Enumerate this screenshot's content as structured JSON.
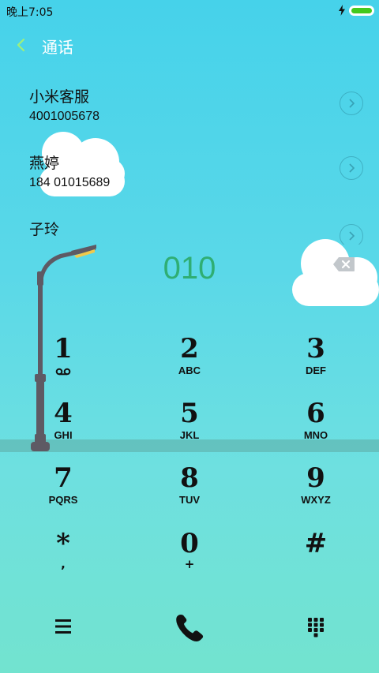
{
  "status_bar": {
    "time": "晚上7:05",
    "battery_level": 1.0,
    "charging": true
  },
  "header": {
    "title": "通话",
    "back_icon": "chevron-left-icon"
  },
  "contacts": [
    {
      "name": "小米客服",
      "number": "4001005678"
    },
    {
      "name": "燕婷",
      "number": "184 01015689"
    },
    {
      "name": "子玲",
      "number": ""
    }
  ],
  "dialed_number": "010",
  "keypad": [
    {
      "digit": "1",
      "sub": "voicemail-icon"
    },
    {
      "digit": "2",
      "sub": "ABC"
    },
    {
      "digit": "3",
      "sub": "DEF"
    },
    {
      "digit": "4",
      "sub": "GHI"
    },
    {
      "digit": "5",
      "sub": "JKL"
    },
    {
      "digit": "6",
      "sub": "MNO"
    },
    {
      "digit": "7",
      "sub": "PQRS"
    },
    {
      "digit": "8",
      "sub": "TUV"
    },
    {
      "digit": "9",
      "sub": "WXYZ"
    },
    {
      "digit": "*",
      "sub": ","
    },
    {
      "digit": "0",
      "sub": "+"
    },
    {
      "digit": "#",
      "sub": ""
    }
  ],
  "bottom_bar": {
    "menu_icon": "menu-icon",
    "call_icon": "phone-icon",
    "dialpad_icon": "dialpad-icon"
  },
  "colors": {
    "accent_green": "#2fae73",
    "battery_green": "#43c91e",
    "sky_top": "#46d2ea",
    "ground": "#72e3cf"
  }
}
